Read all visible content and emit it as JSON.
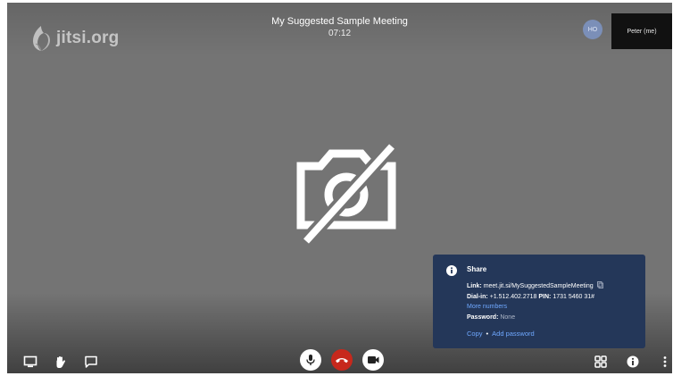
{
  "brand": {
    "logo_text": "jitsi.org",
    "logo_icon": "jitsi-bird-logo-icon"
  },
  "meeting": {
    "title": "My Suggested Sample Meeting",
    "timer": "07:12"
  },
  "participants": {
    "avatar_initials": "HO",
    "self_label": "Peter (me)"
  },
  "video": {
    "camera_state_icon": "camera-off-icon"
  },
  "share": {
    "title": "Share",
    "link_label": "Link:",
    "link_value": "meet.jit.si/MySuggestedSampleMeeting",
    "dialin_label": "Dial-in:",
    "dialin_value": "+1.512.402.2718",
    "pin_label": "PIN:",
    "pin_value": "1731 5460 31#",
    "more_numbers": "More numbers",
    "password_label": "Password:",
    "password_value": "None",
    "copy_label": "Copy",
    "separator": "•",
    "add_password_label": "Add password"
  },
  "colors": {
    "stage": "#747474",
    "share_panel": "#243759",
    "link": "#6fa8ff",
    "hangup": "#c7281c"
  },
  "toolbar": {
    "left_icons": [
      "screen-share-icon",
      "raise-hand-icon",
      "chat-icon"
    ],
    "center_icons": [
      "microphone-icon",
      "hangup-icon",
      "video-camera-icon"
    ],
    "right_icons": [
      "tile-view-icon",
      "info-icon",
      "more-vertical-icon"
    ]
  }
}
